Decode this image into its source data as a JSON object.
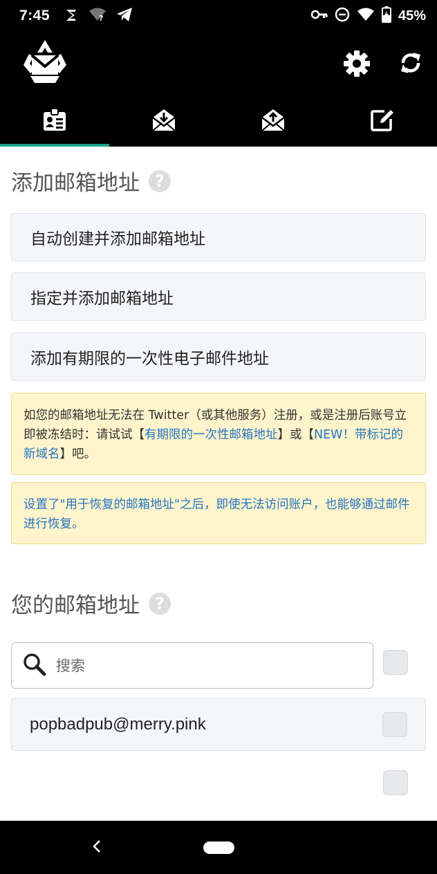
{
  "status_bar": {
    "time": "7:45",
    "battery": "45%",
    "left_icons": [
      "signal-icon",
      "wifi-unknown-icon",
      "telegram-icon"
    ],
    "right_icons": [
      "vpn-key-icon",
      "do-not-disturb-icon",
      "wifi-icon",
      "battery-charging-icon"
    ]
  },
  "app_bar": {
    "icons": [
      "app-logo-icon",
      "gear-icon",
      "refresh-icon"
    ]
  },
  "tabs": [
    {
      "icon": "address-card-icon",
      "active": true
    },
    {
      "icon": "inbox-open-envelope-icon",
      "active": false
    },
    {
      "icon": "outbox-envelope-icon",
      "active": false
    },
    {
      "icon": "compose-icon",
      "active": false
    }
  ],
  "add_section": {
    "title": "添加邮箱地址",
    "buttons": [
      {
        "label": "自动创建并添加邮箱地址"
      },
      {
        "label": "指定并添加邮箱地址"
      },
      {
        "label": "添加有期限的一次性电子邮件地址"
      }
    ],
    "notice1": {
      "text_a": "如您的邮箱地址无法在 Twitter（或其他服务）注册，或是注册后账号立即被冻结时：请试试【",
      "link_a": "有期限的一次性邮箱地址",
      "text_b": "】或【",
      "link_b": "NEW！带标记的新域名",
      "text_c": "】吧。"
    },
    "notice2": {
      "link": "设置了\"用于恢复的邮箱地址\"之后，即使无法访问账户，也能够通过邮件进行恢复。"
    }
  },
  "your_section": {
    "title": "您的邮箱地址",
    "search_placeholder": "搜索",
    "addresses": [
      "popbadpub@merry.pink"
    ]
  },
  "colors": {
    "tab_indicator": "#17a589",
    "link": "#2576c2",
    "notice_bg": "#fff4cc"
  }
}
